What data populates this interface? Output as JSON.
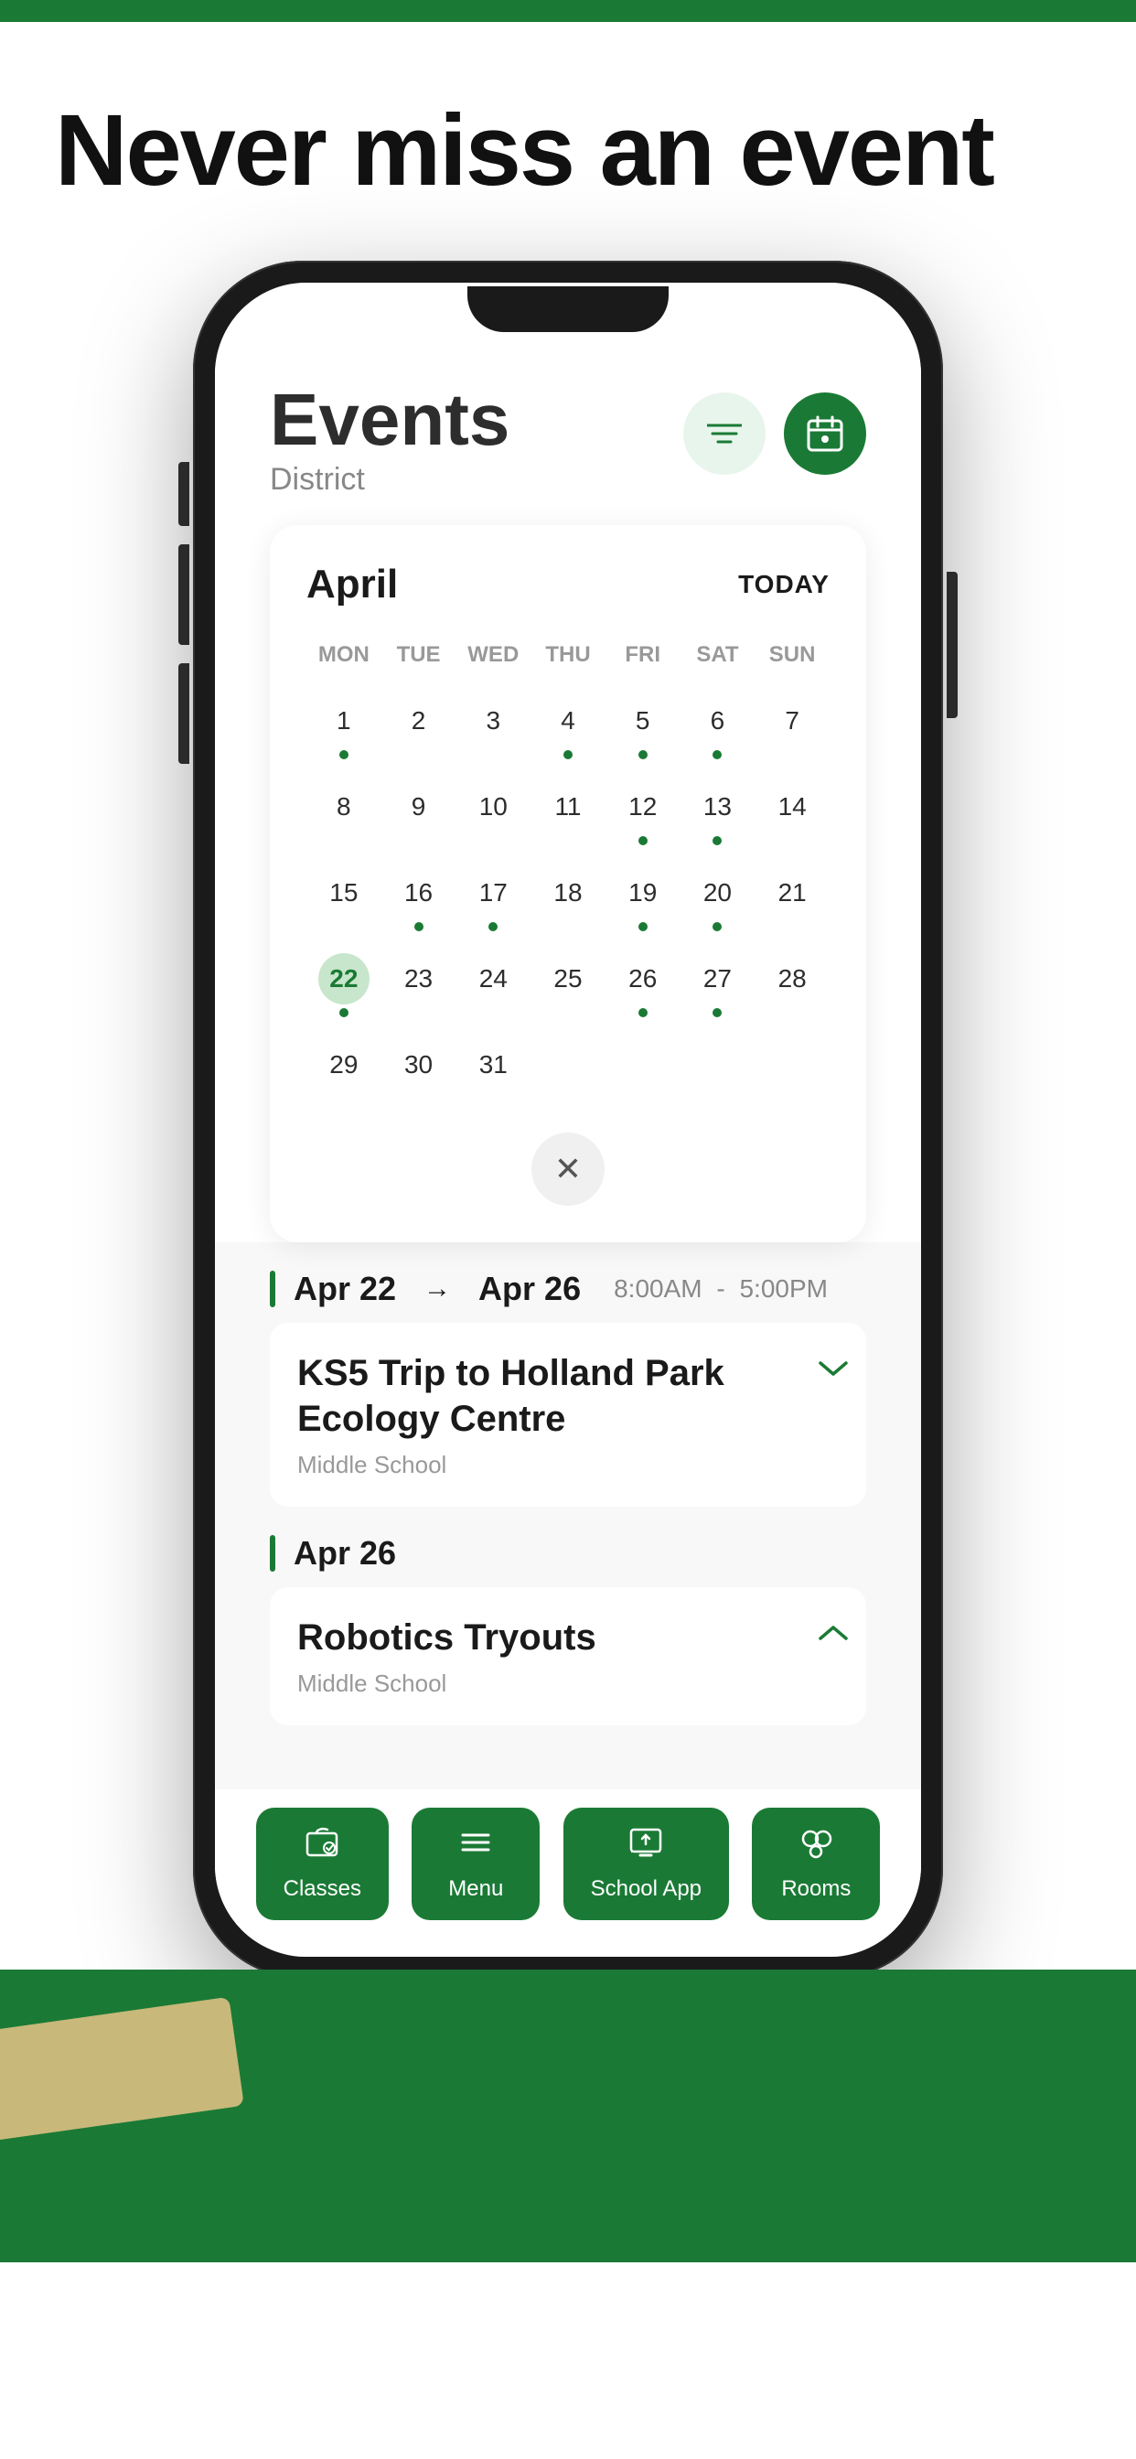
{
  "topBar": {
    "color": "#1a7a35"
  },
  "hero": {
    "title": "Never miss an event"
  },
  "app": {
    "header": {
      "title": "Events",
      "subtitle": "District"
    },
    "filterBtn": {
      "label": "filter"
    },
    "calendarBtn": {
      "label": "calendar"
    },
    "calendar": {
      "month": "April",
      "todayLabel": "TODAY",
      "weekdays": [
        "MON",
        "TUE",
        "WED",
        "THU",
        "FRI",
        "SAT",
        "SUN"
      ],
      "weeks": [
        [
          {
            "num": "1",
            "dot": true,
            "selected": false,
            "col": 1
          },
          {
            "num": "2",
            "dot": false,
            "selected": false
          },
          {
            "num": "3",
            "dot": false,
            "selected": false
          },
          {
            "num": "4",
            "dot": true,
            "selected": false
          },
          {
            "num": "5",
            "dot": true,
            "selected": false
          },
          {
            "num": "6",
            "dot": true,
            "selected": false
          },
          {
            "num": "7",
            "dot": false,
            "selected": false
          }
        ],
        [
          {
            "num": "8",
            "dot": false,
            "selected": false
          },
          {
            "num": "9",
            "dot": false,
            "selected": false
          },
          {
            "num": "10",
            "dot": false,
            "selected": false
          },
          {
            "num": "11",
            "dot": false,
            "selected": false
          },
          {
            "num": "12",
            "dot": true,
            "selected": false
          },
          {
            "num": "13",
            "dot": true,
            "selected": false
          },
          {
            "num": "14",
            "dot": false,
            "selected": false
          }
        ],
        [
          {
            "num": "15",
            "dot": false,
            "selected": false
          },
          {
            "num": "16",
            "dot": true,
            "selected": false
          },
          {
            "num": "17",
            "dot": true,
            "selected": false
          },
          {
            "num": "18",
            "dot": false,
            "selected": false
          },
          {
            "num": "19",
            "dot": true,
            "selected": false
          },
          {
            "num": "20",
            "dot": true,
            "selected": false
          },
          {
            "num": "21",
            "dot": false,
            "selected": false
          }
        ],
        [
          {
            "num": "22",
            "dot": true,
            "selected": true
          },
          {
            "num": "23",
            "dot": false,
            "selected": false
          },
          {
            "num": "24",
            "dot": false,
            "selected": false
          },
          {
            "num": "25",
            "dot": false,
            "selected": false
          },
          {
            "num": "26",
            "dot": true,
            "selected": false
          },
          {
            "num": "27",
            "dot": true,
            "selected": false
          },
          {
            "num": "28",
            "dot": false,
            "selected": false
          }
        ],
        [
          {
            "num": "29",
            "dot": false,
            "selected": false
          },
          {
            "num": "30",
            "dot": false,
            "selected": false
          },
          {
            "num": "31",
            "dot": false,
            "selected": false
          },
          {
            "num": "",
            "dot": false,
            "selected": false
          },
          {
            "num": "",
            "dot": false,
            "selected": false
          },
          {
            "num": "",
            "dot": false,
            "selected": false
          },
          {
            "num": "",
            "dot": false,
            "selected": false
          }
        ]
      ],
      "closeBtn": "✕"
    },
    "events": [
      {
        "dateFrom": "Apr 22",
        "dateTo": "Apr 26",
        "timeFrom": "8:00AM",
        "timeTo": "5:00PM",
        "title": "KS5 Trip to Holland Park Ecology Centre",
        "school": "Middle School",
        "expanded": true,
        "expandIcon": "chevron-down"
      },
      {
        "dateFrom": "Apr 26",
        "dateTo": "",
        "timeFrom": "",
        "timeTo": "",
        "title": "Robotics Tryouts",
        "school": "Middle School",
        "expanded": false,
        "expandIcon": "chevron-up"
      }
    ],
    "bottomNav": {
      "items": [
        {
          "id": "classes",
          "label": "Classes",
          "icon": "classes"
        },
        {
          "id": "menu",
          "label": "Menu",
          "icon": "menu"
        },
        {
          "id": "schoolapp",
          "label": "School App",
          "icon": "schoolapp"
        },
        {
          "id": "rooms",
          "label": "Rooms",
          "icon": "rooms"
        }
      ]
    }
  }
}
